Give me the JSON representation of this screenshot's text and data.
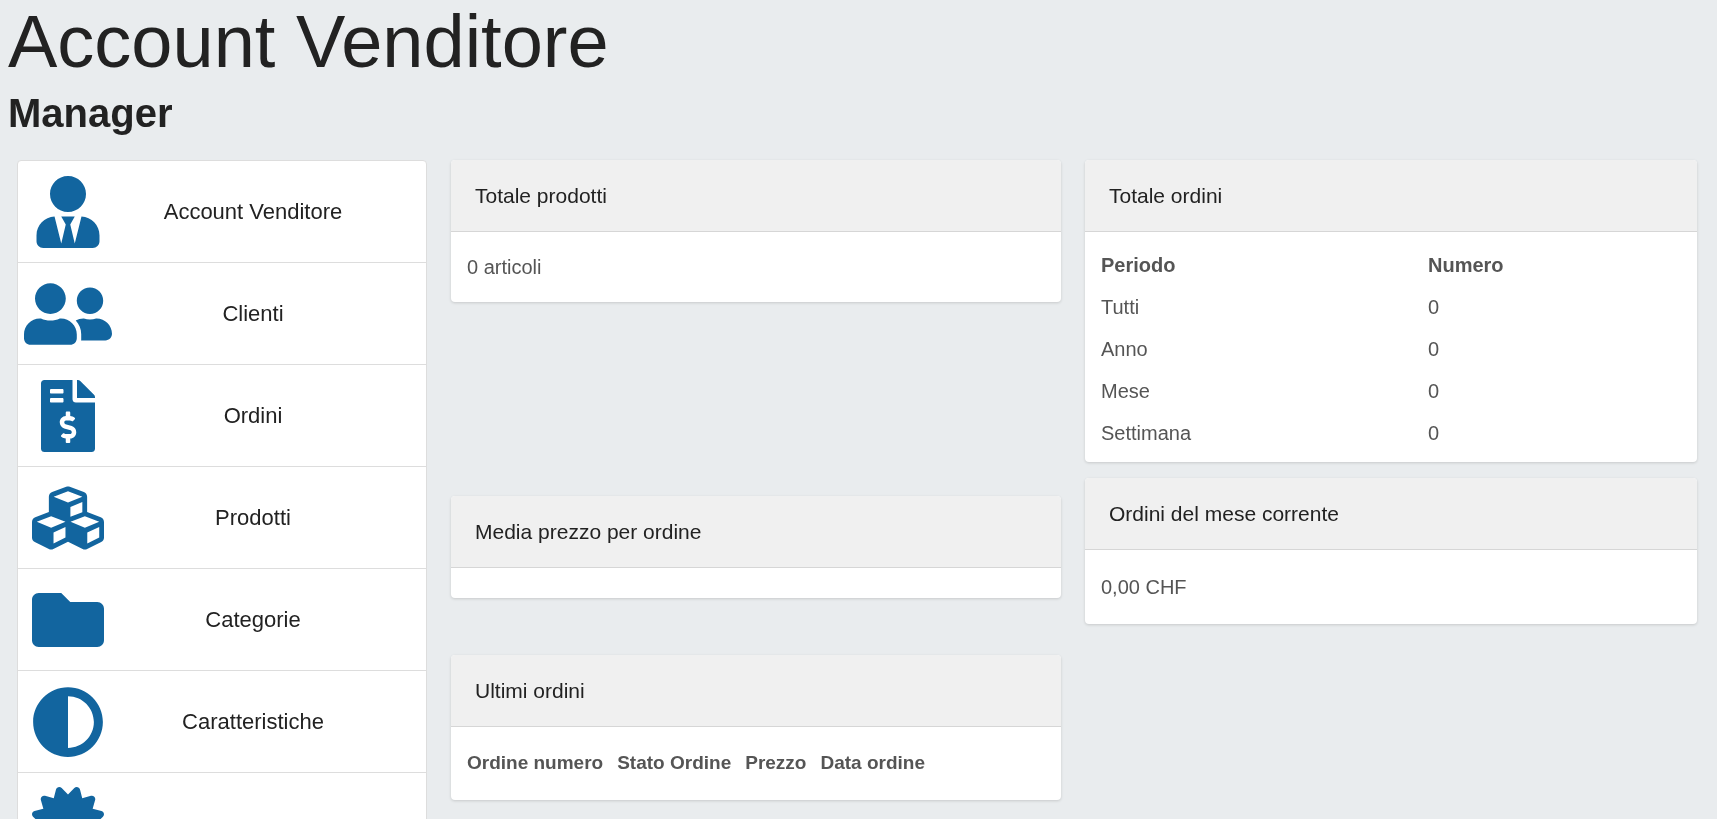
{
  "page": {
    "title": "Account Venditore",
    "subtitle": "Manager"
  },
  "sidebar": {
    "items": [
      {
        "label": "Account Venditore"
      },
      {
        "label": "Clienti"
      },
      {
        "label": "Ordini"
      },
      {
        "label": "Prodotti"
      },
      {
        "label": "Categorie"
      },
      {
        "label": "Caratteristiche"
      }
    ]
  },
  "total_products": {
    "title": "Totale prodotti",
    "value": "0 articoli"
  },
  "average_price": {
    "title": "Media prezzo per ordine"
  },
  "latest_orders": {
    "title": "Ultimi ordini",
    "columns": [
      "Ordine numero",
      "Stato Ordine",
      "Prezzo",
      "Data ordine"
    ]
  },
  "total_orders": {
    "title": "Totale ordini",
    "columns": [
      "Periodo",
      "Numero"
    ],
    "rows": [
      [
        "Tutti",
        "0"
      ],
      [
        "Anno",
        "0"
      ],
      [
        "Mese",
        "0"
      ],
      [
        "Settimana",
        "0"
      ]
    ]
  },
  "month_orders": {
    "title": "Ordini del mese corrente",
    "value": "0,00 CHF"
  }
}
